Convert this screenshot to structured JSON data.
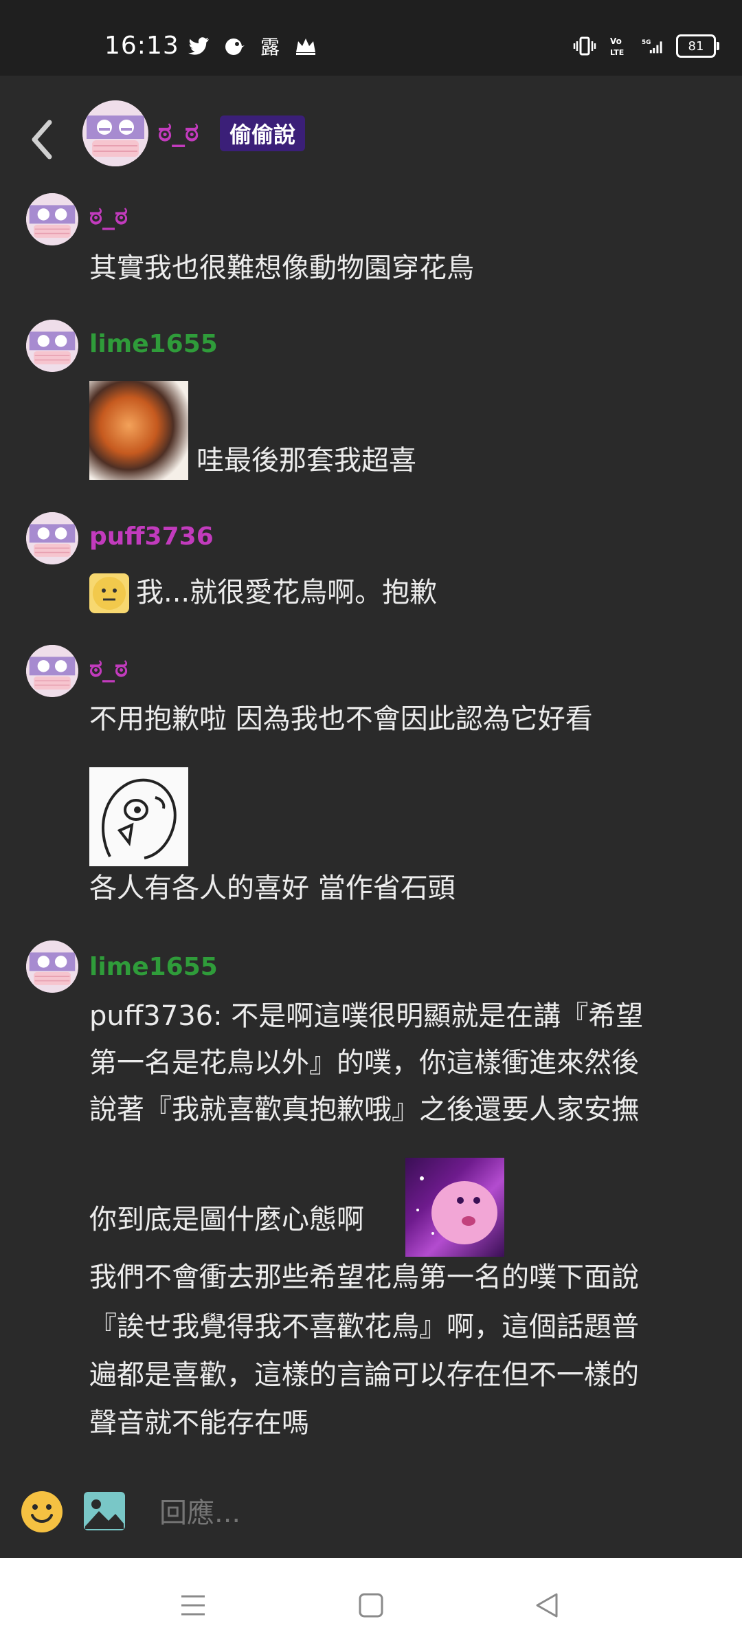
{
  "status": {
    "time": "16:13",
    "left_icons": [
      "twitter-icon",
      "bird-app-icon",
      "露",
      "crown-icon"
    ],
    "right_icons": [
      "vibrate-icon",
      "volte-icon",
      "5g-signal-icon"
    ],
    "battery": "81"
  },
  "header": {
    "name": "ಠ_ಠ",
    "badge": "偷偷說"
  },
  "messages": [
    {
      "name": "ಠ_ಠ",
      "color": "#c23bbd",
      "lines": [
        "其實我也很難想像動物園穿花鳥"
      ]
    },
    {
      "name": "lime1655",
      "color": "#2f9c3a",
      "lines": [
        "哇最後那套我超喜"
      ]
    },
    {
      "name": "puff3736",
      "color": "#c23bbd",
      "lines": [
        "我...就很愛花鳥啊。抱歉"
      ]
    },
    {
      "name": "ಠ_ಠ",
      "color": "#c23bbd",
      "lines": [
        "不用抱歉啦 因為我也不會因此認為它好看",
        "各人有各人的喜好 當作省石頭"
      ]
    },
    {
      "name": "lime1655",
      "color": "#2f9c3a",
      "lines": [
        "puff3736: 不是啊這噗很明顯就是在講『希望",
        "第一名是花鳥以外』的噗，你這樣衝進來然後",
        "說著『我就喜歡真抱歉哦』之後還要人家安撫",
        "你到底是圖什麼心態啊",
        "我們不會衝去那些希望花鳥第一名的噗下面說",
        "『誒せ我覺得我不喜歡花鳥』啊，這個話題普",
        "遍都是喜歡，這樣的言論可以存在但不一樣的",
        "聲音就不能存在嗎"
      ]
    }
  ],
  "composer": {
    "placeholder": "回應..."
  }
}
